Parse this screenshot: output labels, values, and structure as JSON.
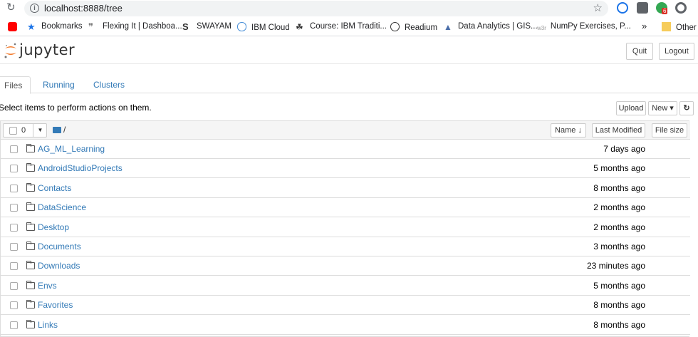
{
  "browser": {
    "url": "localhost:8888/tree",
    "bookmarks": [
      {
        "label": "Bookmarks"
      },
      {
        "label": "Flexing It | Dashboa..."
      },
      {
        "label": "SWAYAM"
      },
      {
        "label": "IBM Cloud"
      },
      {
        "label": "Course: IBM Traditi..."
      },
      {
        "label": "Readium"
      },
      {
        "label": "Data Analytics | GIS..."
      },
      {
        "label": "NumPy Exercises, P..."
      },
      {
        "label": "Other b"
      }
    ],
    "overflow": "»",
    "ext_badge": "6",
    "w3r": "w3r"
  },
  "header": {
    "logo_text": "jupyter",
    "quit_label": "Quit",
    "logout_label": "Logout"
  },
  "tabs": [
    {
      "label": "Files",
      "active": true
    },
    {
      "label": "Running"
    },
    {
      "label": "Clusters"
    }
  ],
  "toolbar": {
    "hint": "Select items to perform actions on them.",
    "upload_label": "Upload",
    "new_label": "New ▾",
    "refresh_icon": "↻"
  },
  "list": {
    "selected_count": "0",
    "path": "/",
    "name_header": "Name ↓",
    "modified_header": "Last Modified",
    "size_header": "File size",
    "items": [
      {
        "name": "AG_ML_Learning",
        "modified": "7 days ago"
      },
      {
        "name": "AndroidStudioProjects",
        "modified": "5 months ago"
      },
      {
        "name": "Contacts",
        "modified": "8 months ago"
      },
      {
        "name": "DataScience",
        "modified": "2 months ago"
      },
      {
        "name": "Desktop",
        "modified": "2 months ago"
      },
      {
        "name": "Documents",
        "modified": "3 months ago"
      },
      {
        "name": "Downloads",
        "modified": "23 minutes ago"
      },
      {
        "name": "Envs",
        "modified": "5 months ago"
      },
      {
        "name": "Favorites",
        "modified": "8 months ago"
      },
      {
        "name": "Links",
        "modified": "8 months ago"
      }
    ]
  },
  "colors": {
    "link": "#337ab7",
    "logo_orange": "#f37726"
  }
}
